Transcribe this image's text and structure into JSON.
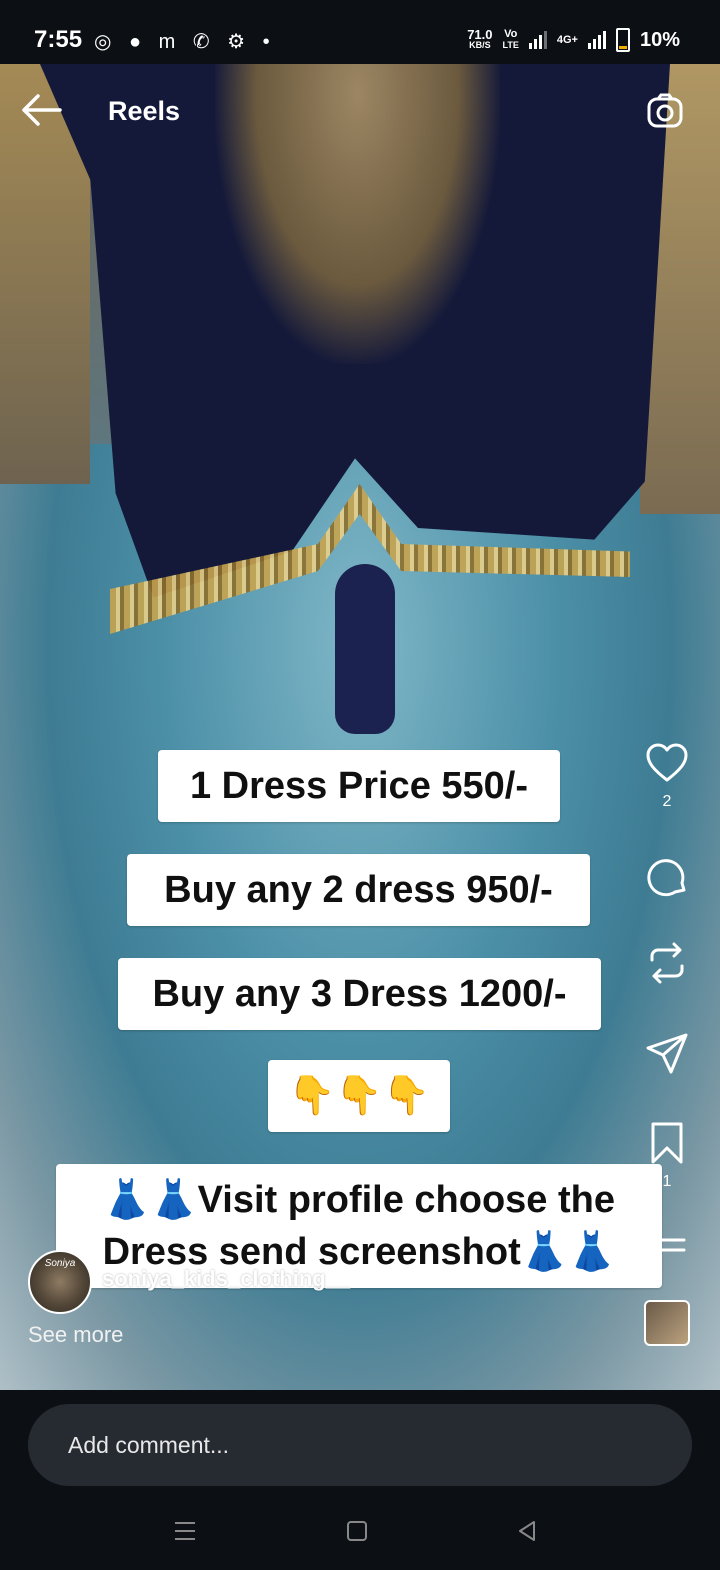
{
  "status_bar": {
    "time": "7:55",
    "notification_icons": [
      "whatsapp-icon",
      "chat-bubble-icon",
      "m-app-icon",
      "phone-icon",
      "settings-icon",
      "dot-icon"
    ],
    "notification_glyphs": "◎ ● m ✆ ⚙ •",
    "net_speed": "71.0",
    "net_unit": "KB/S",
    "volte_top": "Vo",
    "volte_bottom": "LTE",
    "network_type": "4G+",
    "battery": "10%",
    "battery_color": "#f2b100"
  },
  "header": {
    "title": "Reels"
  },
  "captions": [
    "1 Dress Price 550/-",
    "Buy any 2 dress 950/-",
    "Buy any 3 Dress 1200/-",
    "👇👇👇",
    "👗👗Visit profile choose the",
    "Dress send screenshot👗👗"
  ],
  "actions": {
    "like_count": "2",
    "save_count": "1"
  },
  "reel": {
    "avatar_text": "Soniya",
    "username": "soniya_kids_clothing__",
    "see_more": "See more"
  },
  "comment_bar": {
    "placeholder": "Add comment..."
  }
}
